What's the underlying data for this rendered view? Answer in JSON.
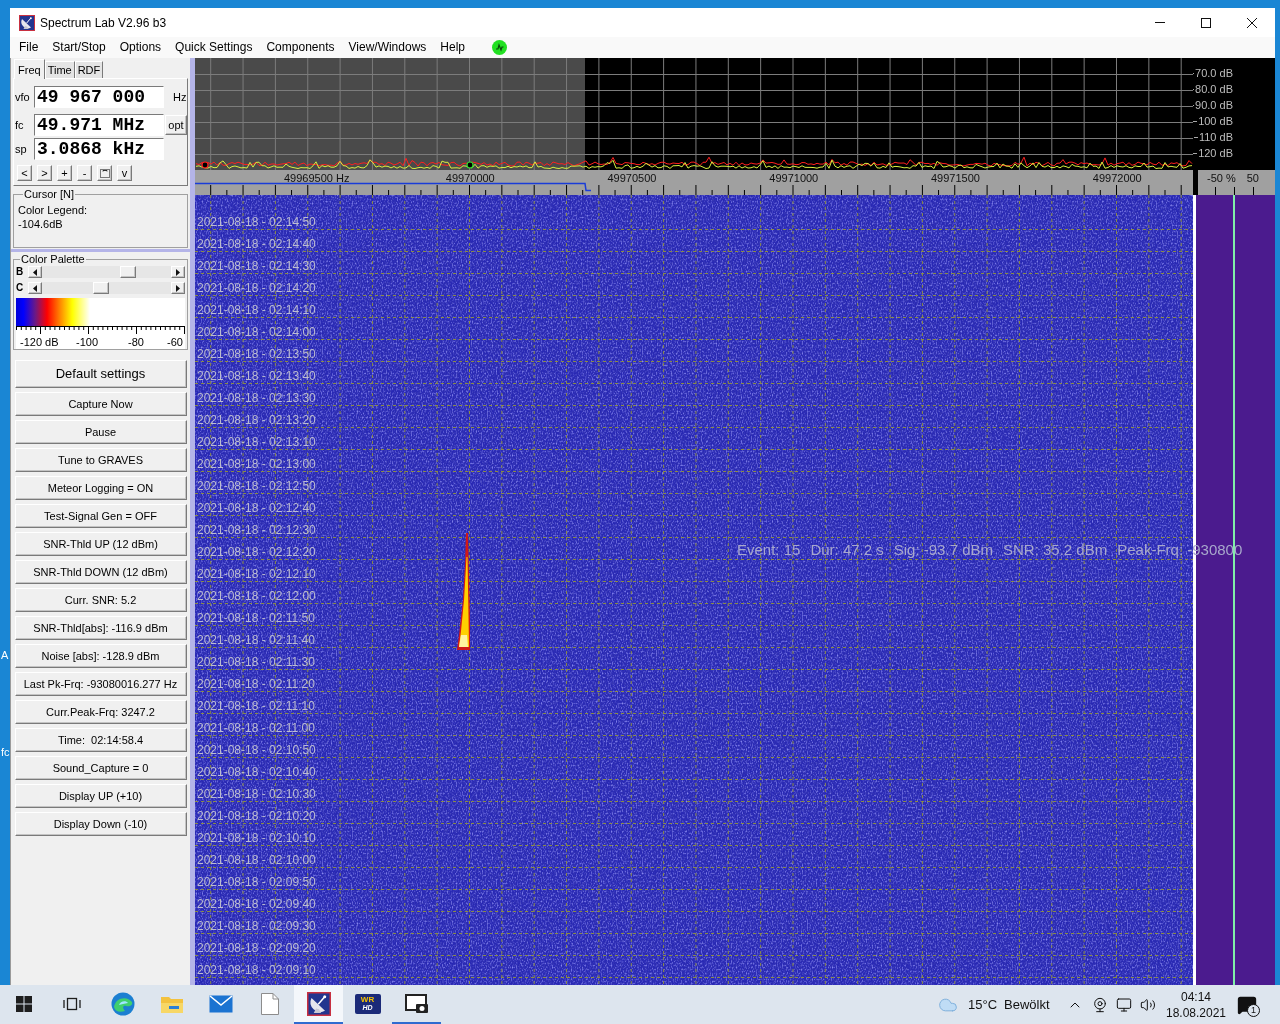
{
  "window": {
    "title": "Spectrum Lab V2.96 b3"
  },
  "menu": [
    "File",
    "Start/Stop",
    "Options",
    "Quick Settings",
    "Components",
    "View/Windows",
    "Help"
  ],
  "side_panel": {
    "tabs": [
      {
        "label": "Freq",
        "selected": true
      },
      {
        "label": "Time",
        "selected": false
      },
      {
        "label": "RDF",
        "selected": false
      }
    ],
    "fields": [
      {
        "label": "vfo",
        "value": "49 967 000",
        "unit": "Hz"
      },
      {
        "label": "fc",
        "value": "49.971 MHz",
        "button": "opt"
      },
      {
        "label": "sp",
        "value": "3.0868 kHz"
      }
    ],
    "nav_buttons": [
      {
        "kind": "text",
        "label": "<"
      },
      {
        "kind": "text",
        "label": ">"
      },
      {
        "kind": "text",
        "label": "+"
      },
      {
        "kind": "text",
        "label": "-"
      },
      {
        "kind": "icon"
      },
      {
        "kind": "text",
        "label": "v"
      }
    ],
    "cursor": {
      "title": "Cursor [N]",
      "lines": [
        "Color Legend:",
        "-104.6dB"
      ]
    },
    "color_palette": {
      "title": "Color Palette",
      "sliders": [
        {
          "label": "B",
          "level": 0.69
        },
        {
          "label": "C",
          "level": 0.45
        }
      ],
      "scale_labels": [
        "-120 dB",
        "-100",
        "-80",
        "-60"
      ]
    },
    "buttons": [
      "Default settings",
      "Capture Now",
      "Pause",
      "Tune to GRAVES",
      "Meteor Logging = ON",
      "Test-Signal Gen = OFF",
      "SNR-Thld UP (12 dBm)",
      "SNR-Thld DOWN (12 dBm)",
      "Curr. SNR: 5.2",
      "SNR-Thld[abs]: -116.9 dBm",
      "Noise [abs]: -128.9 dBm",
      "Last Pk-Frq: -93080016.277 Hz",
      "Curr.Peak-Frq: 3247.2",
      "Time:  02:14:58.4",
      "Sound_Capture = 0",
      "Display UP (+10)",
      "Display Down (-10)"
    ]
  },
  "spectrum": {
    "db_labels": [
      "70.0 dB",
      "80.0 dB",
      "90.0 dB",
      "100 dB",
      "110 dB",
      "120 dB"
    ],
    "freq_labels": [
      "49969500 Hz",
      "49970000",
      "49970500",
      "49971000",
      "49971500",
      "49972000"
    ],
    "percent_labels": [
      "-50 %",
      "50"
    ]
  },
  "waterfall": {
    "timestamps": [
      "2021-08-18 - 02:14:50",
      "2021-08-18 - 02:14:40",
      "2021-08-18 - 02:14:30",
      "2021-08-18 - 02:14:20",
      "2021-08-18 - 02:14:10",
      "2021-08-18 - 02:14:00",
      "2021-08-18 - 02:13:50",
      "2021-08-18 - 02:13:40",
      "2021-08-18 - 02:13:30",
      "2021-08-18 - 02:13:20",
      "2021-08-18 - 02:13:10",
      "2021-08-18 - 02:13:00",
      "2021-08-18 - 02:12:50",
      "2021-08-18 - 02:12:40",
      "2021-08-18 - 02:12:30",
      "2021-08-18 - 02:12:20",
      "2021-08-18 - 02:12:10",
      "2021-08-18 - 02:12:00",
      "2021-08-18 - 02:11:50",
      "2021-08-18 - 02:11:40",
      "2021-08-18 - 02:11:30",
      "2021-08-18 - 02:11:20",
      "2021-08-18 - 02:11:10",
      "2021-08-18 - 02:11:00",
      "2021-08-18 - 02:10:50",
      "2021-08-18 - 02:10:40",
      "2021-08-18 - 02:10:30",
      "2021-08-18 - 02:10:20",
      "2021-08-18 - 02:10:10",
      "2021-08-18 - 02:10:00",
      "2021-08-18 - 02:09:50",
      "2021-08-18 - 02:09:40",
      "2021-08-18 - 02:09:30",
      "2021-08-18 - 02:09:20",
      "2021-08-18 - 02:09:10"
    ],
    "event_info": [
      "Event: 15",
      "Dur: 47.2 s",
      "Sig: -93.7 dBm",
      "SNR: 35.2 dBm",
      "Peak-Frq: -930800"
    ]
  },
  "desktop_labels": [
    "A",
    "fc"
  ],
  "taskbar": {
    "items": [
      {
        "kind": "start",
        "running": false,
        "selected": false
      },
      {
        "kind": "task_view",
        "running": false,
        "selected": false
      },
      {
        "kind": "browser",
        "running": false,
        "selected": false
      },
      {
        "kind": "explorer",
        "running": false,
        "selected": false
      },
      {
        "kind": "mail",
        "running": false,
        "selected": false
      },
      {
        "kind": "document",
        "running": false,
        "selected": false
      },
      {
        "kind": "spectrum_lab",
        "running": true,
        "selected": true
      },
      {
        "kind": "wr_hd",
        "logo_text": [
          "WR",
          "HD"
        ],
        "running": false,
        "selected": false
      },
      {
        "kind": "capture",
        "running": true,
        "selected": false
      }
    ],
    "weather": {
      "temperature": "15°C",
      "condition": "Bewölkt"
    },
    "clock": {
      "time": "04:14",
      "date": "18.08.2021"
    },
    "notification_count": "1"
  }
}
